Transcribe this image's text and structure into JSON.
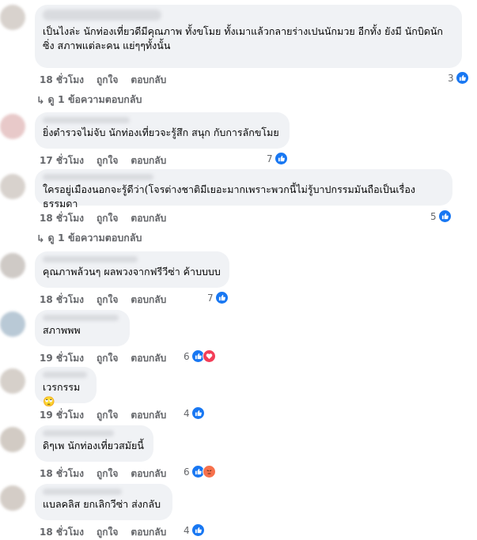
{
  "labels": {
    "like": "ถูกใจ",
    "reply": "ตอบกลับ"
  },
  "comments": [
    {
      "text": "เป็นไงล่ะ นักท่องเที่ยวดีมีคุณภาพ ทั้งขโมย ทั้งเมาแล้วกลายร่างเปนนักมวย อีกทั้ง ยังมี นักบิดนัก\nซิ่ง สภาพแต่ละคน แย่ๆๆทั้งนั้น",
      "time": "18 ชั่วโมง",
      "count": "3",
      "replies": "ดู 1 ข้อความตอบกลับ"
    },
    {
      "text": "ยิ่งตำรวจไม่จับ นักท่องเที่ยวจะรู้สึก สนุก กับการลักขโมย",
      "time": "17 ชั่วโมง",
      "count": "7"
    },
    {
      "text": "ใครอยู่เมืองนอกจะรู้ดีว่า(โจรต่างชาติมีเยอะมากเพราะพวกนี้ไม่รู้บาปกรรมมันถือเป็นเรื่องธรรมดา",
      "time": "18 ชั่วโมง",
      "count": "5",
      "replies": "ดู 1 ข้อความตอบกลับ"
    },
    {
      "text": "คุณภาพล้วนๆ ผลพวงจากฟรีวีซ่า ค้าบบบบ",
      "time": "18 ชั่วโมง",
      "count": "7"
    },
    {
      "text": "สภาพพพ",
      "time": "19 ชั่วโมง",
      "count": "6"
    },
    {
      "text": "เวรกรรม 🙄",
      "time": "19 ชั่วโมง",
      "count": "4"
    },
    {
      "text": "ดิๆเพ นักท่องเที่ยวสมัยนี้",
      "time": "18 ชั่วโมง",
      "count": "6"
    },
    {
      "text": "แบลคลิส ยกเลิกวีซ่า ส่งกลับ",
      "time": "18 ชั่วโมง",
      "count": "4"
    }
  ],
  "colors": {
    "like": "#1877f2",
    "love": "#f33e58",
    "angry": "#f7714c"
  }
}
